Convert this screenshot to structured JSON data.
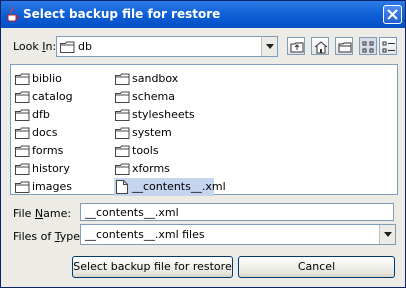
{
  "window": {
    "title": "Select backup file for restore"
  },
  "lookin": {
    "label": "Look In:",
    "value": "db"
  },
  "toolbar": {
    "up_icon": "up-one-level-icon",
    "home_icon": "home-icon",
    "new_folder_icon": "new-folder-icon",
    "list_view_icon": "list-view-icon",
    "details_view_icon": "details-view-icon"
  },
  "files": {
    "col1": [
      "biblio",
      "catalog",
      "dfb",
      "docs",
      "forms",
      "history",
      "images"
    ],
    "col2": [
      "sandbox",
      "schema",
      "stylesheets",
      "system",
      "tools",
      "xforms",
      "__contents__.xml"
    ]
  },
  "file_name": {
    "label": "File Name:",
    "value": "__contents__.xml"
  },
  "file_type": {
    "label": "Files of Type:",
    "value": "__contents__.xml files"
  },
  "buttons": {
    "approve": "Select backup file for restore",
    "cancel": "Cancel"
  },
  "colors": {
    "titlebar": "#0a5bd3",
    "selection": "#c5d5f0",
    "border": "#7f9db9"
  }
}
